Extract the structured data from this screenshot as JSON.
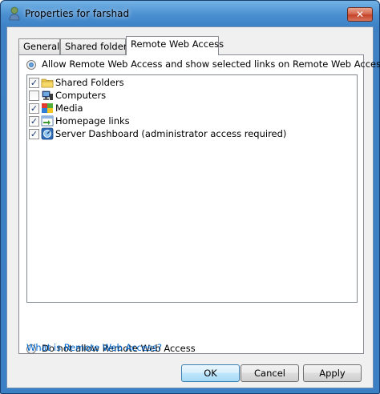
{
  "window": {
    "title": "Properties for farshad"
  },
  "title_bar": {
    "close_label": "✕"
  },
  "tabs": [
    {
      "label": "General",
      "active": false
    },
    {
      "label": "Shared folders",
      "active": false
    },
    {
      "label": "Remote Web Access",
      "active": true
    }
  ],
  "options": {
    "allow_label": "Allow Remote Web Access and show selected links on Remote Web Access:",
    "allow_selected": true,
    "deny_label": "Do not allow Remote Web Access",
    "deny_selected": false
  },
  "links_list": [
    {
      "label": "Shared Folders",
      "checked": true,
      "icon": "folder-icon"
    },
    {
      "label": "Computers",
      "checked": false,
      "icon": "computers-icon"
    },
    {
      "label": "Media",
      "checked": true,
      "icon": "media-icon"
    },
    {
      "label": "Homepage links",
      "checked": true,
      "icon": "homepage-links-icon"
    },
    {
      "label": "Server Dashboard (administrator access required)",
      "checked": true,
      "icon": "server-dashboard-icon"
    }
  ],
  "help_link": "What is Remote Web Access?",
  "buttons": {
    "ok": "OK",
    "cancel": "Cancel",
    "apply": "Apply"
  },
  "colors": {
    "link": "#0066cc",
    "title_bar": "#4a8fd0",
    "close_button": "#c4432a"
  }
}
